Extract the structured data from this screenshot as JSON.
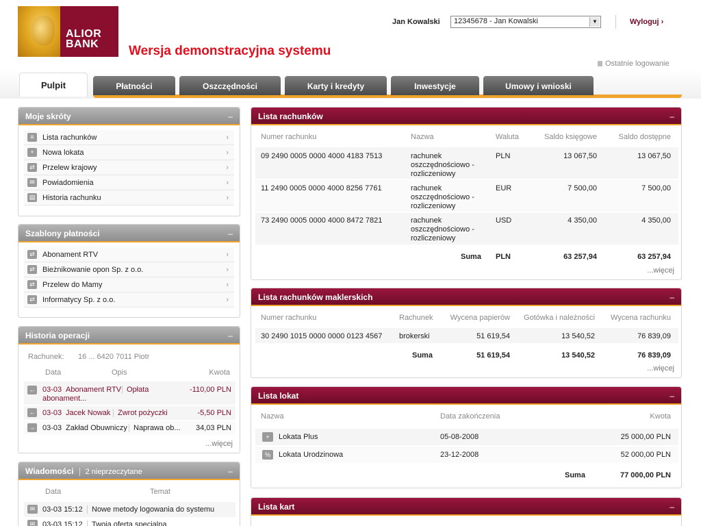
{
  "header": {
    "logo_line1": "ALIOR",
    "logo_line2": "BANK",
    "demo_title": "Wersja demonstracyjna systemu",
    "user_name": "Jan Kowalski",
    "account_select": "12345678 - Jan Kowalski",
    "logout": "Wyloguj",
    "logout_chevron": "›",
    "last_login": "Ostatnie logowanie"
  },
  "tabs": [
    "Pulpit",
    "Płatności",
    "Oszczędności",
    "Karty i kredyty",
    "Inwestycje",
    "Umowy i wnioski"
  ],
  "minimize": "–",
  "chevron": "›",
  "shortcuts": {
    "title": "Moje skróty",
    "items": [
      "Lista rachunków",
      "Nowa lokata",
      "Przelew krajowy",
      "Powiadomienia",
      "Historia rachunku"
    ]
  },
  "templates": {
    "title": "Szablony płatności",
    "items": [
      "Abonament RTV",
      "Bieżnikowanie opon Sp. z o.o.",
      "Przelew do Mamy",
      "Informatycy Sp. z o.o."
    ]
  },
  "history": {
    "title": "Historia operacji",
    "account_label": "Rachunek:",
    "account_value": "16 ... 6420 7011  Piotr",
    "col_date": "Data",
    "col_desc": "Opis",
    "col_amount": "Kwota",
    "rows": [
      {
        "date": "03-03",
        "who": "Abonament RTV",
        "what": "Opłata",
        "extra": "abonament...",
        "amount": "-110,00 PLN"
      },
      {
        "date": "03-03",
        "who": "Jacek Nowak",
        "what": "Zwrot pożyczki",
        "extra": "",
        "amount": "-5,50 PLN"
      },
      {
        "date": "03-03",
        "who": "Zakład Obuwniczy",
        "what": "Naprawa ob...",
        "extra": "",
        "amount": "34,03 PLN"
      }
    ],
    "more": "...więcej"
  },
  "messages": {
    "title": "Wiadomości",
    "unread": "2 nieprzeczytane",
    "col_date": "Data",
    "col_subject": "Temat",
    "rows": [
      {
        "date": "03-03 15:12",
        "subject": "Nowe metody logowania do systemu"
      },
      {
        "date": "03-03 15:12",
        "subject": "Twoja oferta specjalna"
      }
    ]
  },
  "accounts": {
    "title": "Lista rachunków",
    "col_number": "Numer rachunku",
    "col_name": "Nazwa",
    "col_currency": "Waluta",
    "col_book": "Saldo księgowe",
    "col_avail": "Saldo dostępne",
    "rows": [
      {
        "number": "09 2490 0005 0000 4000 4183 7513",
        "name1": "rachunek",
        "name2": "oszczędnościowo -",
        "name3": "rozliczeniowy",
        "currency": "PLN",
        "book": "13 067,50",
        "avail": "13 067,50"
      },
      {
        "number": "11 2490 0005 0000 4000 8256 7761",
        "name1": "rachunek",
        "name2": "oszczędnościowo -",
        "name3": "rozliczeniowy",
        "currency": "EUR",
        "book": "7 500,00",
        "avail": "7 500,00"
      },
      {
        "number": "73 2490 0005 0000 4000 8472 7821",
        "name1": "rachunek",
        "name2": "oszczędnościowo -",
        "name3": "rozliczeniowy",
        "currency": "USD",
        "book": "4 350,00",
        "avail": "4 350,00"
      }
    ],
    "sum_label": "Suma",
    "sum_currency": "PLN",
    "sum_book": "63 257,94",
    "sum_avail": "63 257,94",
    "more": "...więcej"
  },
  "brokerage": {
    "title": "Lista rachunków maklerskich",
    "col_number": "Numer rachunku",
    "col_account": "Rachunek",
    "col_papers": "Wycena papierów",
    "col_cash": "Gotówka i należności",
    "col_value": "Wycena rachunku",
    "row": {
      "number": "30 2490 1015 0000 0000 0123 4567",
      "account": "brokerski",
      "papers": "51 619,54",
      "cash": "13 540,52",
      "value": "76 839,09"
    },
    "sum_label": "Suma",
    "sum_papers": "51 619,54",
    "sum_cash": "13 540,52",
    "sum_value": "76 839,09",
    "more": "...więcej"
  },
  "deposits": {
    "title": "Lista lokat",
    "col_name": "Nazwa",
    "col_end": "Data zakończenia",
    "col_amount": "Kwota",
    "rows": [
      {
        "name": "Lokata Plus",
        "end": "05-08-2008",
        "amount": "25 000,00 PLN"
      },
      {
        "name": "Lokata Urodzinowa",
        "end": "23-12-2008",
        "amount": "52 000,00 PLN"
      }
    ],
    "sum_label": "Suma",
    "sum_amount": "77 000,00 PLN"
  },
  "cards": {
    "title": "Lista kart"
  }
}
